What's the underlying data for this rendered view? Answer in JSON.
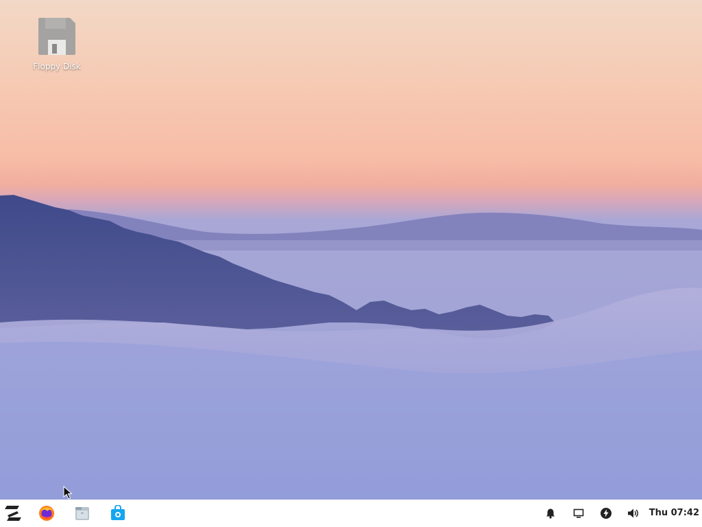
{
  "desktop": {
    "icons": [
      {
        "label": "Floppy Disk",
        "icon": "floppy-disk-icon"
      }
    ]
  },
  "taskbar": {
    "apps": [
      {
        "name": "zorin-menu",
        "icon": "zorin-logo-icon"
      },
      {
        "name": "firefox",
        "icon": "firefox-icon"
      },
      {
        "name": "files",
        "icon": "files-icon"
      },
      {
        "name": "software",
        "icon": "software-store-icon"
      }
    ],
    "tray": [
      {
        "name": "notifications",
        "icon": "bell-icon"
      },
      {
        "name": "display",
        "icon": "display-icon"
      },
      {
        "name": "power",
        "icon": "power-icon"
      },
      {
        "name": "volume",
        "icon": "volume-icon"
      }
    ],
    "clock": "Thu 07:42"
  },
  "colors": {
    "taskbar_bg": "#ffffff",
    "zorin_blue": "#15a6f0",
    "text_dark": "#222222"
  }
}
